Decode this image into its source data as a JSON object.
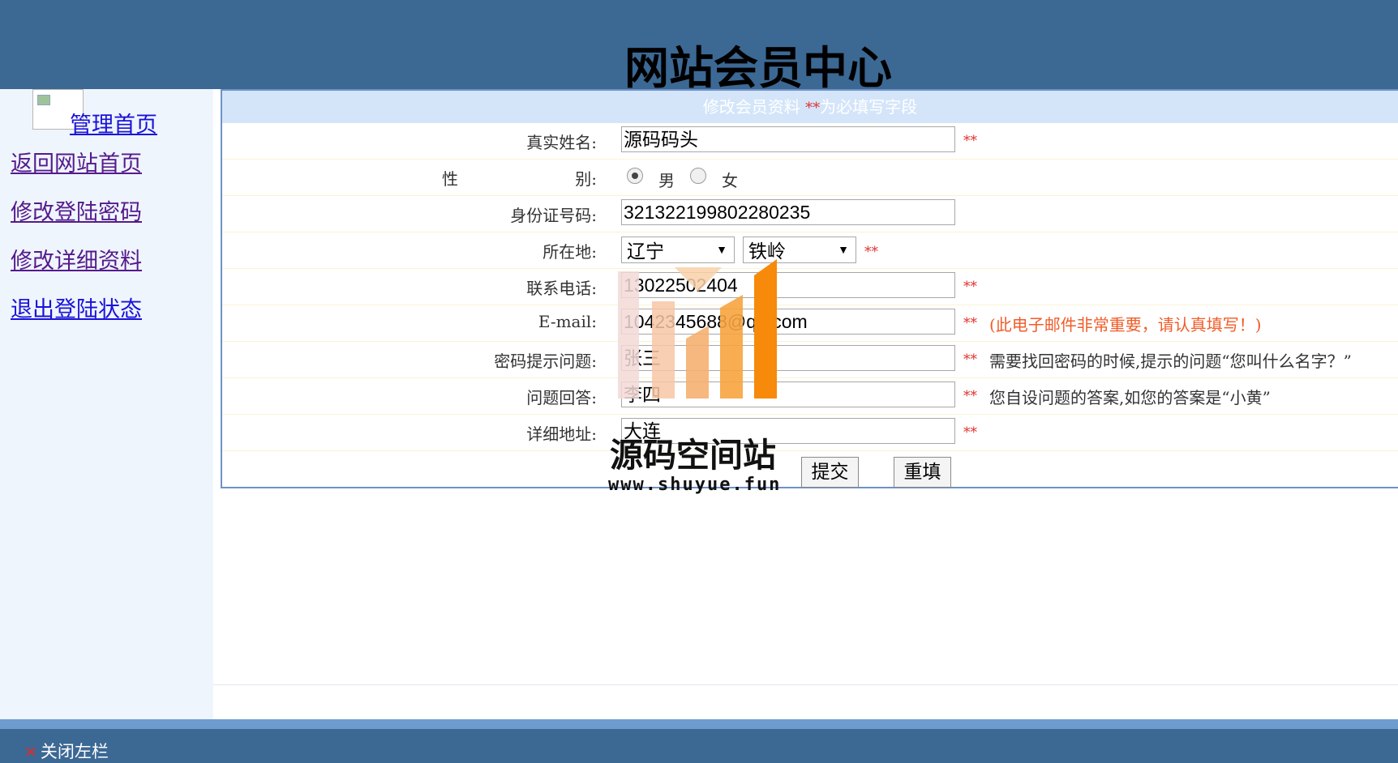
{
  "header": {
    "title": "网站会员中心"
  },
  "sidebar": {
    "home_link": "管理首页",
    "links": [
      "返回网站首页",
      "修改登陆密码",
      "修改详细资料",
      "退出登陆状态"
    ]
  },
  "form": {
    "heading": "修改会员资料",
    "heading_req": "**",
    "heading_suffix": "为必填写字段",
    "required_mark": "**",
    "real_name": {
      "label": "真实姓名:",
      "value": "源码码头"
    },
    "gender": {
      "label_a": "性",
      "label_b": "别:",
      "male": "男",
      "female": "女",
      "selected": "男"
    },
    "id_number": {
      "label": "身份证号码:",
      "value": "321322199802280235"
    },
    "location": {
      "label": "所在地:",
      "province": "辽宁",
      "city": "铁岭"
    },
    "phone": {
      "label": "联系电话:",
      "value": "13022502404"
    },
    "email": {
      "label": "E-mail:",
      "value": "1042345688@qq.com",
      "hint": "(此电子邮件非常重要，请认真填写！)"
    },
    "question": {
      "label": "密码提示问题:",
      "value": "张三",
      "hint": "需要找回密码的时候,提示的问题“您叫什么名字？”"
    },
    "answer": {
      "label": "问题回答:",
      "value": "李四",
      "hint": "您自设问题的答案,如您的答案是“小黄”"
    },
    "address": {
      "label": "详细地址:",
      "value": "大连"
    },
    "submit_label": "提交",
    "reset_label": "重填"
  },
  "footer": {
    "close_left": "关闭左栏",
    "close_icon": "close-icon"
  },
  "watermark": {
    "name": "源码空间站",
    "url": "www.shuyue.fun"
  },
  "colors": {
    "header": "#3c6894",
    "sidebar": "#eef5fd",
    "panel_border": "#6f92c7",
    "required": "#e0302c",
    "hint_orange": "#f05c28"
  }
}
